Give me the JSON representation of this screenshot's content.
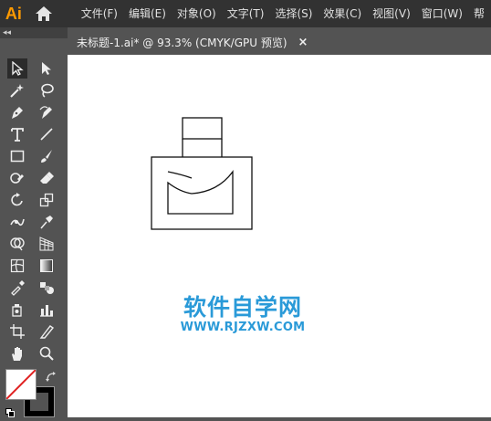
{
  "app": {
    "logo_text": "Ai",
    "accent": "#ff9a00",
    "home_icon": "home-icon"
  },
  "menu": {
    "items": [
      "文件(F)",
      "编辑(E)",
      "对象(O)",
      "文字(T)",
      "选择(S)",
      "效果(C)",
      "视图(V)",
      "窗口(W)",
      "帮"
    ]
  },
  "panel": {
    "collapse_label": "◂◂"
  },
  "document": {
    "tab_title": "未标题-1.ai* @ 93.3% (CMYK/GPU 预览)",
    "close_label": "×"
  },
  "tools": [
    "selection-tool",
    "direct-selection-tool",
    "magic-wand-tool",
    "lasso-tool",
    "pen-tool",
    "curvature-tool",
    "type-tool",
    "line-segment-tool",
    "rectangle-tool",
    "paintbrush-tool",
    "shaper-tool",
    "eraser-tool",
    "rotate-tool",
    "scale-tool",
    "width-tool",
    "puppet-warp-tool",
    "shape-builder-tool",
    "perspective-grid-tool",
    "mesh-tool",
    "gradient-tool",
    "eyedropper-tool",
    "blend-tool",
    "symbol-sprayer-tool",
    "column-graph-tool",
    "artboard-tool",
    "slice-tool",
    "hand-tool",
    "zoom-tool"
  ],
  "colors": {
    "fill": "#ffffff",
    "stroke": "#000000",
    "fill_none_slash": "#e02020"
  },
  "watermark": {
    "title": "软件自学网",
    "url": "WWW.RJZXW.COM",
    "color": "#2a9ad8"
  }
}
